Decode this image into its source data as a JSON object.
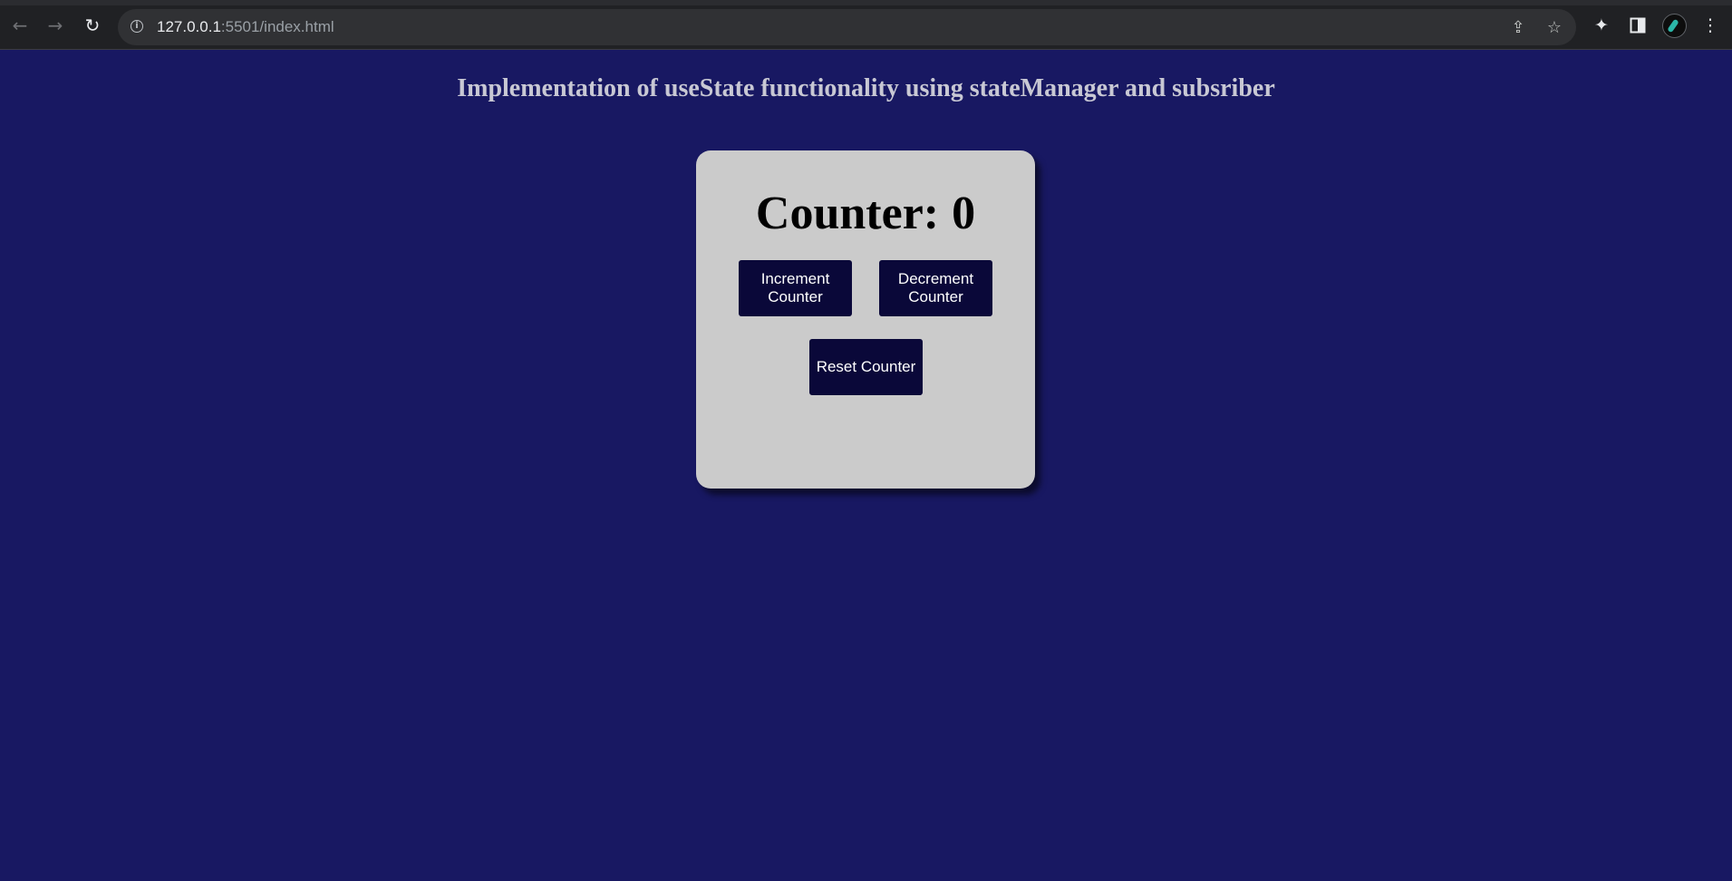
{
  "browser": {
    "url_host": "127.0.0.1",
    "url_rest": ":5501/index.html"
  },
  "page": {
    "title": "Implementation of useState functionality using stateManager and subsriber"
  },
  "counter": {
    "label": "Counter:",
    "value": "0"
  },
  "buttons": {
    "increment": "Increment Counter",
    "decrement": "Decrement Counter",
    "reset": "Reset Counter"
  },
  "colors": {
    "page_background": "#181862",
    "card_background": "#cbcbcb",
    "button_background": "#0a0839",
    "title_text": "#c8c8d4"
  }
}
